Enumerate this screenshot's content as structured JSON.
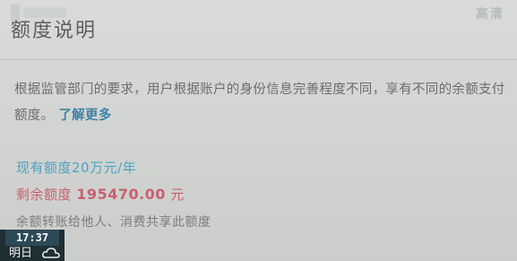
{
  "watermark": "高清",
  "page": {
    "title": "额度说明",
    "description": "根据监管部门的要求，用户根据账户的身份信息完善程度不同，享有不同的余额支付额度。",
    "learn_more": "了解更多"
  },
  "quota": {
    "current_limit": "现有额度20万元/年",
    "remaining_label": "剩余额度",
    "remaining_value": "195470.00",
    "remaining_unit": "元",
    "note": "余额转账给他人、消费共享此额度"
  },
  "overlay": {
    "time": "17:37",
    "day": "明日",
    "weather_icon": "cloud-icon"
  },
  "colors": {
    "accent_blue": "#4ba3c4",
    "accent_red": "#c9616e",
    "link": "#3f83a6"
  }
}
